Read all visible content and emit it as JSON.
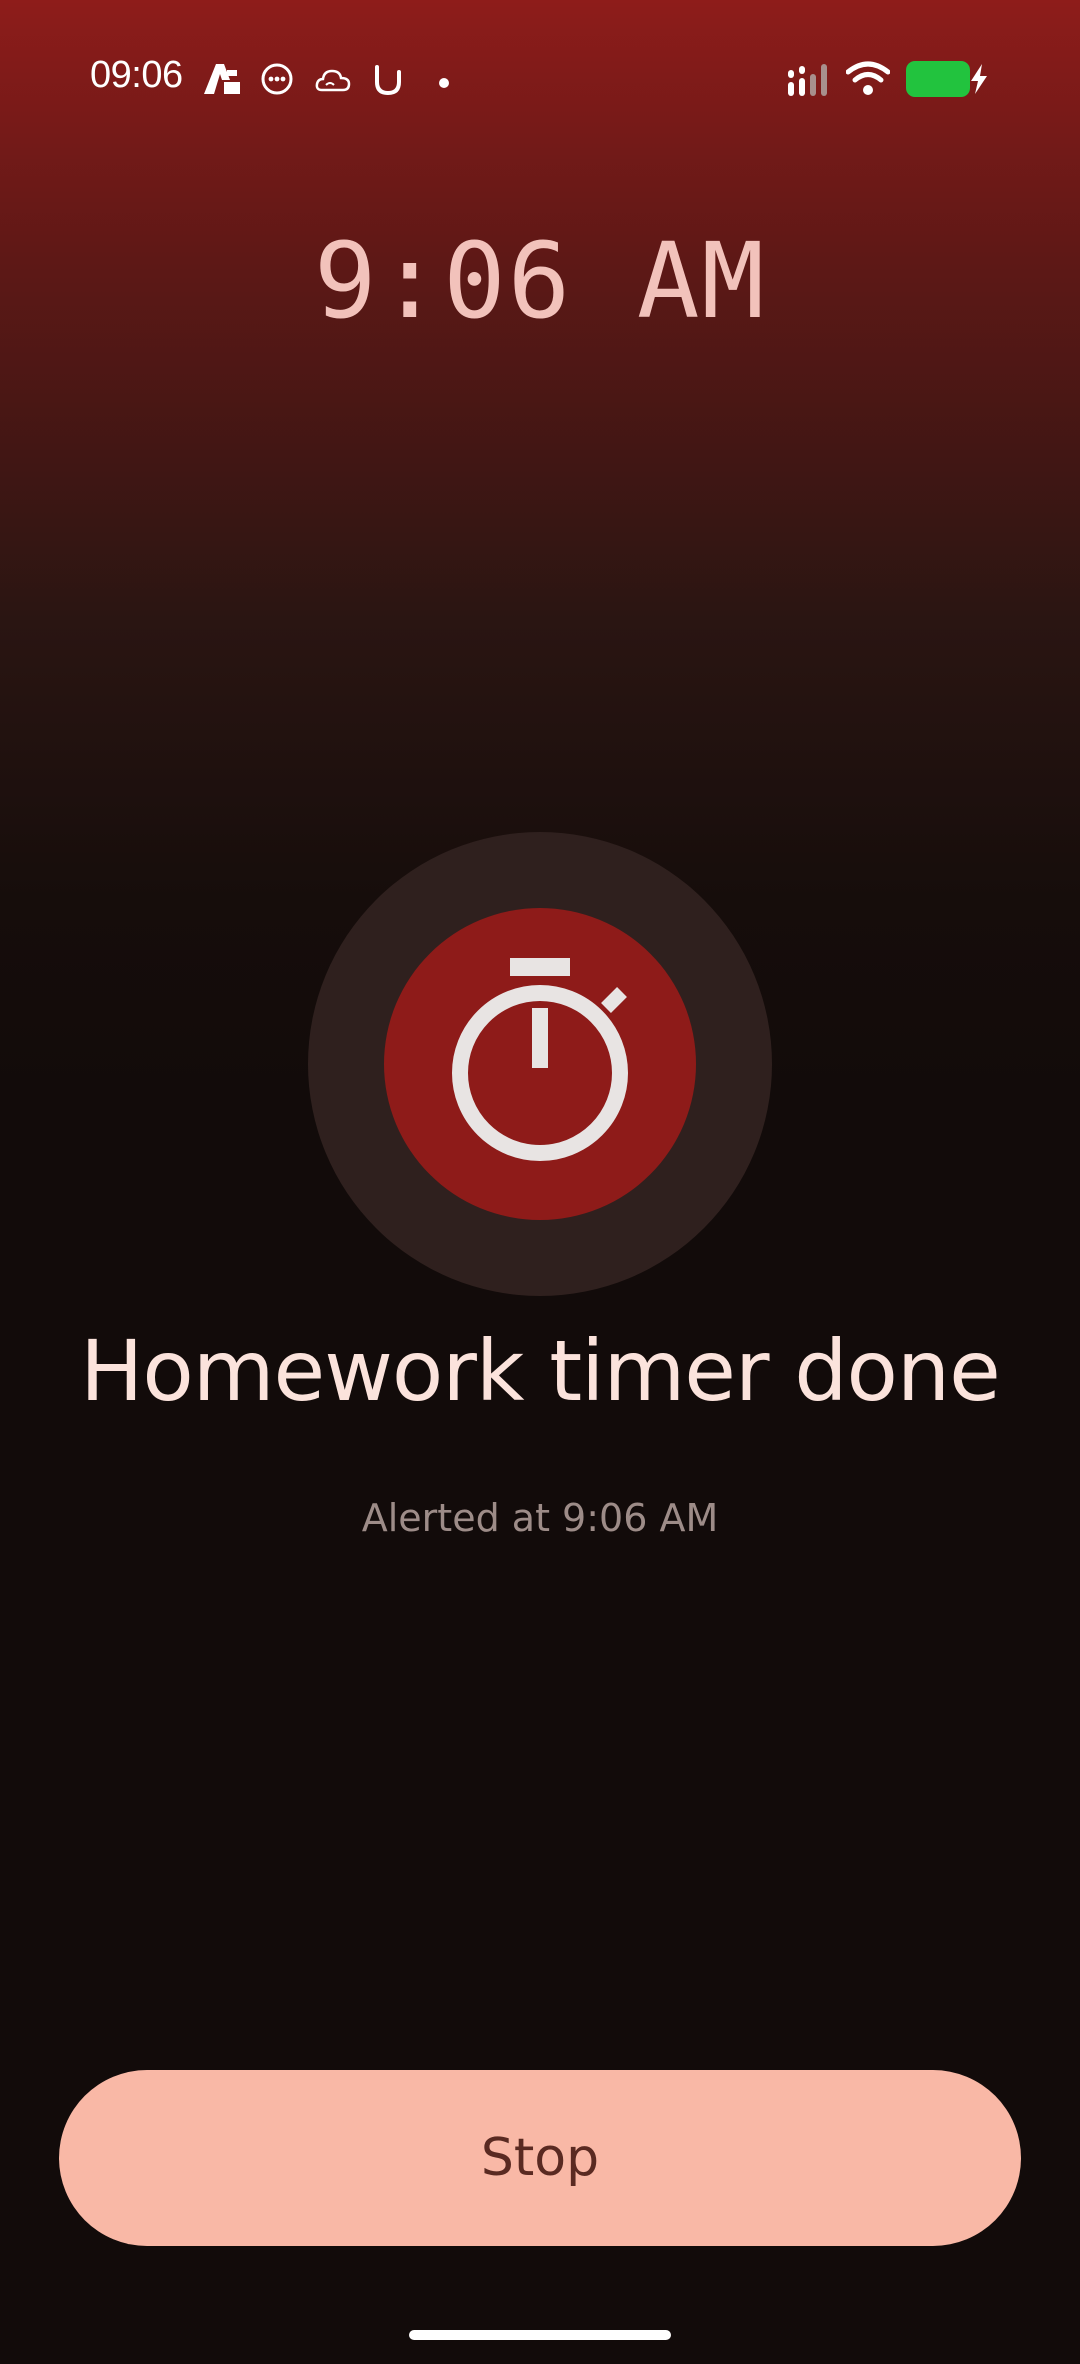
{
  "status_bar": {
    "time": "09:06",
    "left_icons": [
      "app-a-icon",
      "chat-bubble-icon",
      "cloud-icon",
      "u-app-icon",
      "dot-icon"
    ],
    "right_icons": [
      "signal-icon",
      "wifi-icon",
      "battery-icon",
      "charging-bolt-icon"
    ],
    "battery_color": "#22c33e"
  },
  "clock": {
    "time": "9:06 AM"
  },
  "alert": {
    "icon": "stopwatch-icon",
    "title": "Homework timer done",
    "subtitle": "Alerted at 9:06 AM"
  },
  "actions": {
    "stop_label": "Stop"
  },
  "colors": {
    "accent_red": "#8e1b19",
    "button_bg": "#f9b8a6",
    "button_text": "#5a2a22"
  }
}
